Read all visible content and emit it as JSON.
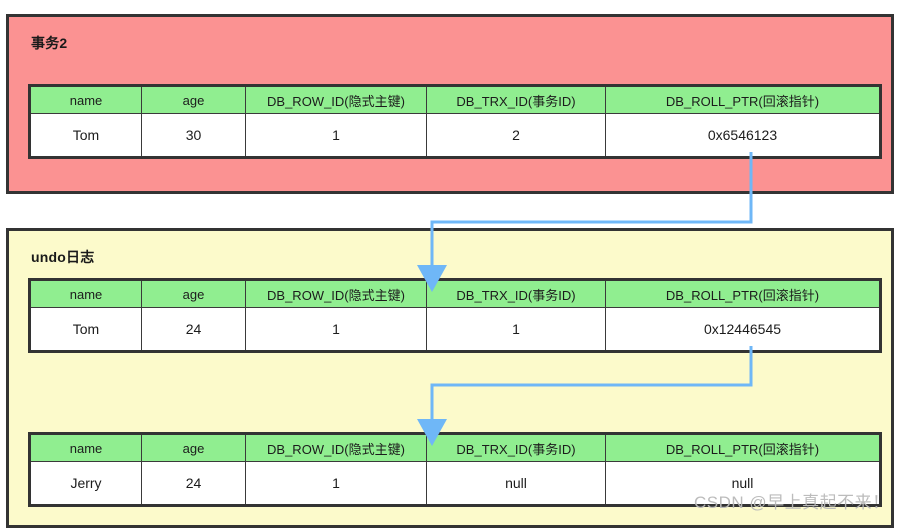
{
  "diagram": {
    "watermark": "CSDN @早上真起不来！",
    "colors": {
      "transaction_panel_bg": "#FB9292",
      "undo_panel_bg": "#FCFACB",
      "table_header_bg": "#90EE90",
      "table_cell_bg": "#FFFFFF",
      "border": "#333333",
      "arrow": "#6FB7F7"
    },
    "columns": [
      "name",
      "age",
      "DB_ROW_ID(隐式主键)",
      "DB_TRX_ID(事务ID)",
      "DB_ROLL_PTR(回滚指针)"
    ],
    "panels": [
      {
        "id": "transaction",
        "title": "事务2",
        "tables": [
          {
            "id": "txn-record",
            "row": [
              "Tom",
              "30",
              "1",
              "2",
              "0x6546123"
            ]
          }
        ]
      },
      {
        "id": "undo-log",
        "title": "undo日志",
        "tables": [
          {
            "id": "undo-record-1",
            "row": [
              "Tom",
              "24",
              "1",
              "1",
              "0x12446545"
            ]
          },
          {
            "id": "undo-record-2",
            "row": [
              "Jerry",
              "24",
              "1",
              "null",
              "null"
            ]
          }
        ]
      }
    ]
  }
}
